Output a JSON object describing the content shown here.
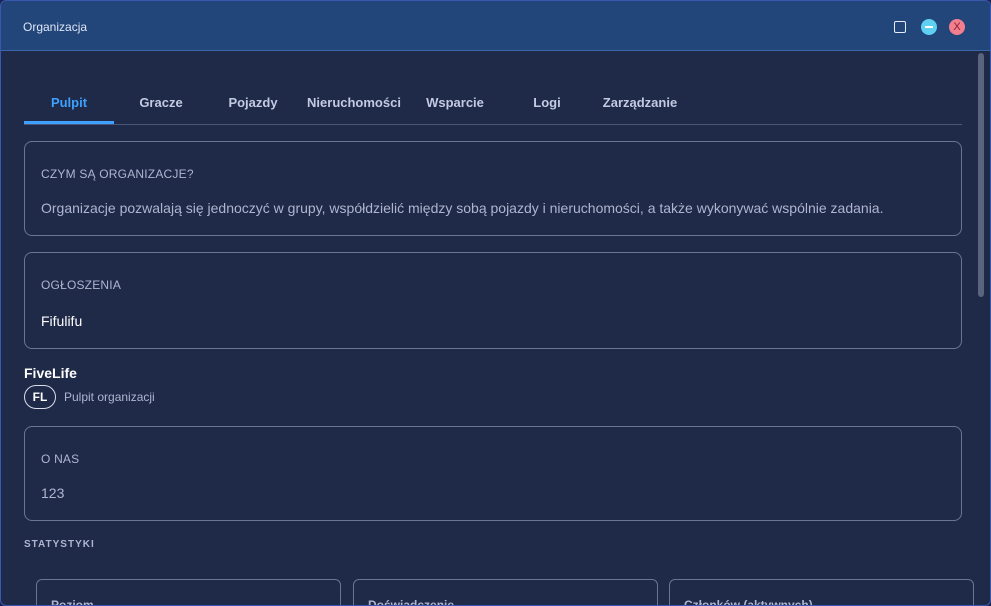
{
  "window": {
    "title": "Organizacja",
    "close_label": "X"
  },
  "tabs": [
    {
      "label": "Pulpit",
      "active": true
    },
    {
      "label": "Gracze",
      "active": false
    },
    {
      "label": "Pojazdy",
      "active": false
    },
    {
      "label": "Nieruchomości",
      "active": false
    },
    {
      "label": "Wsparcie",
      "active": false
    },
    {
      "label": "Logi",
      "active": false
    },
    {
      "label": "Zarządzanie",
      "active": false
    }
  ],
  "info_card": {
    "label": "CZYM SĄ ORGANIZACJE?",
    "text": "Organizacje pozwalają się jednoczyć w grupy, współdzielić między sobą pojazdy i nieruchomości, a także wykonywać wspólnie zadania."
  },
  "announcements_card": {
    "label": "OGŁOSZENIA",
    "text": "Fifulifu"
  },
  "organization": {
    "name": "FiveLife",
    "badge": "FL",
    "subtitle": "Pulpit organizacji"
  },
  "about_card": {
    "label": "O NAS",
    "text": "123"
  },
  "stats": {
    "title": "STATYSTYKI",
    "items": [
      {
        "label": "Poziom"
      },
      {
        "label": "Doświadczenie"
      },
      {
        "label": "Członków (aktywnych)"
      }
    ]
  },
  "colors": {
    "accent": "#3ea0ff",
    "background": "#1f2948",
    "titlebar": "#22457a"
  }
}
